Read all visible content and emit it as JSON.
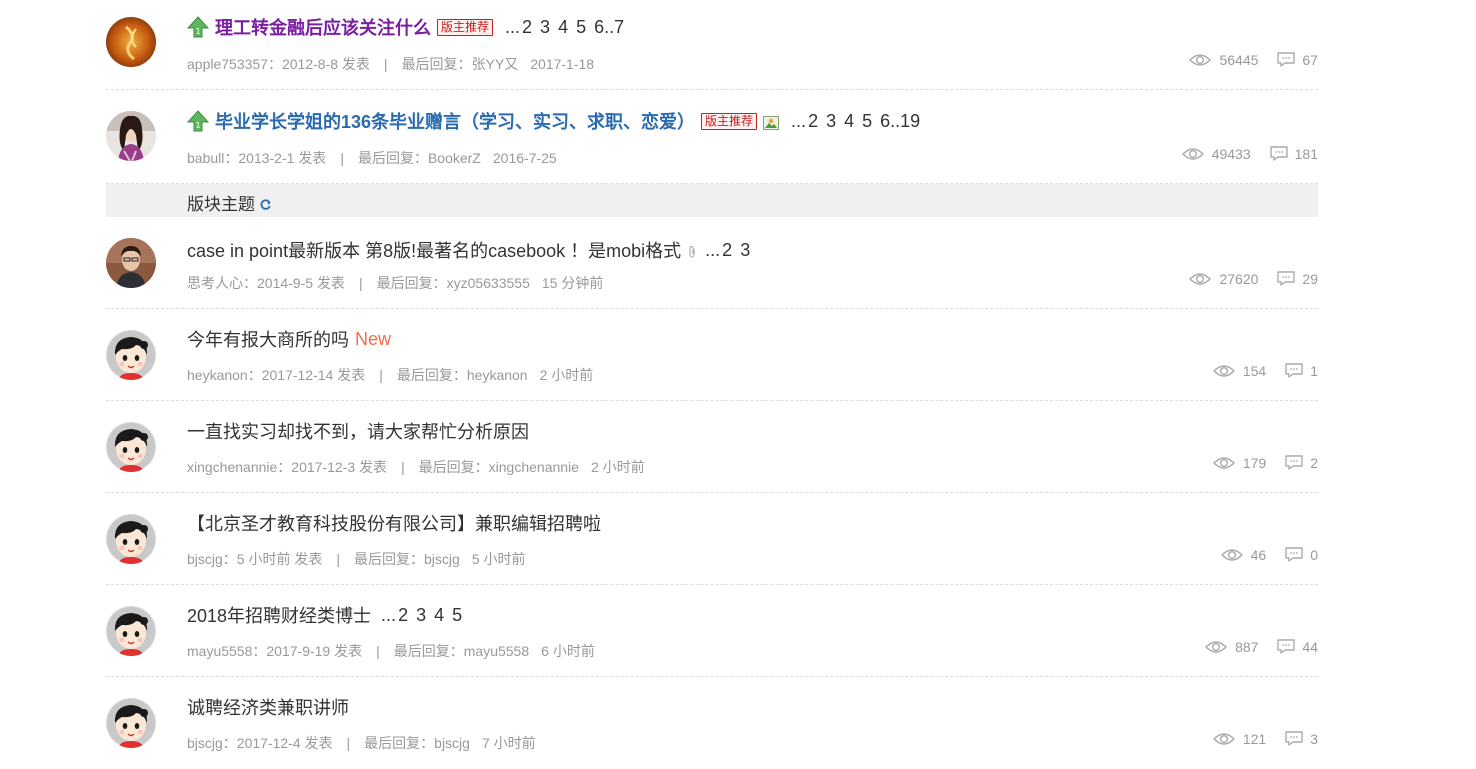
{
  "sticky_threads": [
    {
      "title": "理工转金融后应该关注什么",
      "badge": "版主推荐",
      "pages": [
        "...",
        "2",
        "3",
        "4",
        "5",
        "6",
        "..7"
      ],
      "author": "apple753357",
      "post_date": "2012-8-8",
      "post_suffix": "发表",
      "last_reply_label": "最后回复：",
      "last_reply_user": "张YY又",
      "last_reply_time": "2017-1-18",
      "views": "56445",
      "replies": "67"
    },
    {
      "title": "毕业学长学姐的136条毕业赠言（学习、实习、求职、恋爱）",
      "badge": "版主推荐",
      "pages": [
        "...",
        "2",
        "3",
        "4",
        "5",
        "6",
        "..19"
      ],
      "author": "babull",
      "post_date": "2013-2-1",
      "post_suffix": "发表",
      "last_reply_label": "最后回复：",
      "last_reply_user": "BookerZ",
      "last_reply_time": "2016-7-25",
      "views": "49433",
      "replies": "181"
    }
  ],
  "section": {
    "title": "版块主题"
  },
  "threads": [
    {
      "title": "case in point最新版本 第8版!最著名的casebook ！是mobi格式",
      "has_attachment": true,
      "pages": [
        "...",
        "2",
        "3"
      ],
      "is_new": false,
      "author": "思考人心",
      "post_date": "2014-9-5",
      "post_suffix": "发表",
      "last_reply_label": "最后回复：",
      "last_reply_user": "xyz05633555",
      "last_reply_time": "15 分钟前",
      "views": "27620",
      "replies": "29"
    },
    {
      "title": "今年有报大商所的吗",
      "new_label": "New",
      "author": "heykanon",
      "post_date": "2017-12-14",
      "post_suffix": "发表",
      "last_reply_label": "最后回复：",
      "last_reply_user": "heykanon",
      "last_reply_time": "2 小时前",
      "views": "154",
      "replies": "1"
    },
    {
      "title": "一直找实习却找不到，请大家帮忙分析原因",
      "author": "xingchenannie",
      "post_date": "2017-12-3",
      "post_suffix": "发表",
      "last_reply_label": "最后回复：",
      "last_reply_user": "xingchenannie",
      "last_reply_time": "2 小时前",
      "views": "179",
      "replies": "2"
    },
    {
      "title": "【北京圣才教育科技股份有限公司】兼职编辑招聘啦",
      "author": "bjscjg",
      "post_date": "5 小时前",
      "post_suffix": "发表",
      "last_reply_label": "最后回复：",
      "last_reply_user": "bjscjg",
      "last_reply_time": "5 小时前",
      "views": "46",
      "replies": "0"
    },
    {
      "title": "2018年招聘财经类博士",
      "pages": [
        "...",
        "2",
        "3",
        "4",
        "5"
      ],
      "author": "mayu5558",
      "post_date": "2017-9-19",
      "post_suffix": "发表",
      "last_reply_label": "最后回复：",
      "last_reply_user": "mayu5558",
      "last_reply_time": "6 小时前",
      "views": "887",
      "replies": "44"
    },
    {
      "title": "诚聘经济类兼职讲师",
      "author": "bjscjg",
      "post_date": "2017-12-4",
      "post_suffix": "发表",
      "last_reply_label": "最后回复：",
      "last_reply_user": "bjscjg",
      "last_reply_time": "7 小时前",
      "views": "121",
      "replies": "3"
    }
  ],
  "colors": {
    "sticky_title_purple": "#7b1fa2",
    "sticky_title_blue": "#2a6bb0",
    "new_tag": "#f26c4f",
    "meta_text": "#999999",
    "section_bg": "#f0f0f0"
  },
  "separator": "|"
}
